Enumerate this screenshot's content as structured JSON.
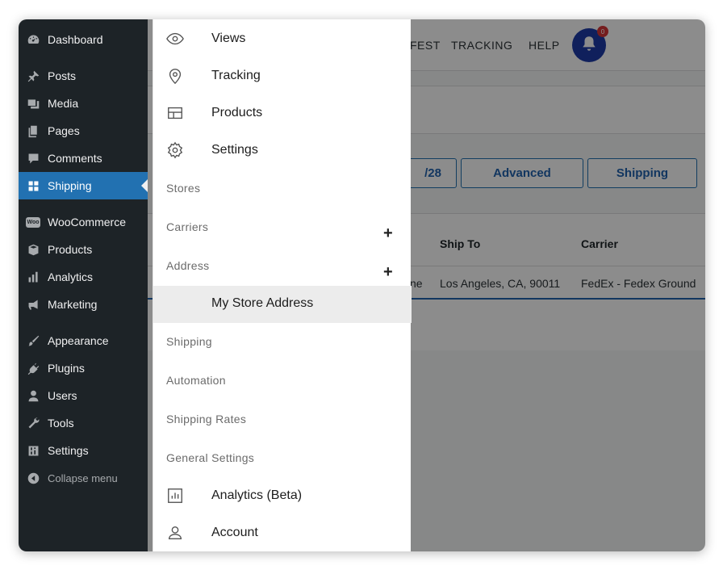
{
  "sidebar": {
    "items": [
      {
        "label": "Dashboard"
      },
      {
        "label": "Posts"
      },
      {
        "label": "Media"
      },
      {
        "label": "Pages"
      },
      {
        "label": "Comments"
      },
      {
        "label": "Shipping"
      },
      {
        "label": "WooCommerce"
      },
      {
        "label": "Products"
      },
      {
        "label": "Analytics"
      },
      {
        "label": "Marketing"
      },
      {
        "label": "Appearance"
      },
      {
        "label": "Plugins"
      },
      {
        "label": "Users"
      },
      {
        "label": "Tools"
      },
      {
        "label": "Settings"
      },
      {
        "label": "Collapse menu"
      }
    ],
    "woo_badge": "Woo"
  },
  "topnav": {
    "manifest_partial": "FEST",
    "tracking": "TRACKING",
    "help": "HELP",
    "notification_count": "0"
  },
  "filters": {
    "date_partial": "/28",
    "advanced": "Advanced",
    "shipping": "Shipping"
  },
  "table": {
    "headers": {
      "ship_to": "Ship To",
      "carrier": "Carrier"
    },
    "row": {
      "partial": "ne",
      "ship_to": "Los Angeles, CA, 90011",
      "carrier": "FedEx - Fedex Ground"
    }
  },
  "menu": {
    "views": "Views",
    "tracking": "Tracking",
    "products": "Products",
    "settings": "Settings",
    "stores": "Stores",
    "carriers": "Carriers",
    "address": "Address",
    "my_store_address": "My Store Address",
    "shipping": "Shipping",
    "automation": "Automation",
    "shipping_rates": "Shipping Rates",
    "general_settings": "General Settings",
    "analytics_beta": "Analytics (Beta)",
    "account": "Account",
    "expand_symbol": "+"
  },
  "colors": {
    "sidebar_bg": "#1d2327",
    "active_item": "#2271b1",
    "accent_blue": "#1e3ba8",
    "badge_red": "#d63638"
  }
}
